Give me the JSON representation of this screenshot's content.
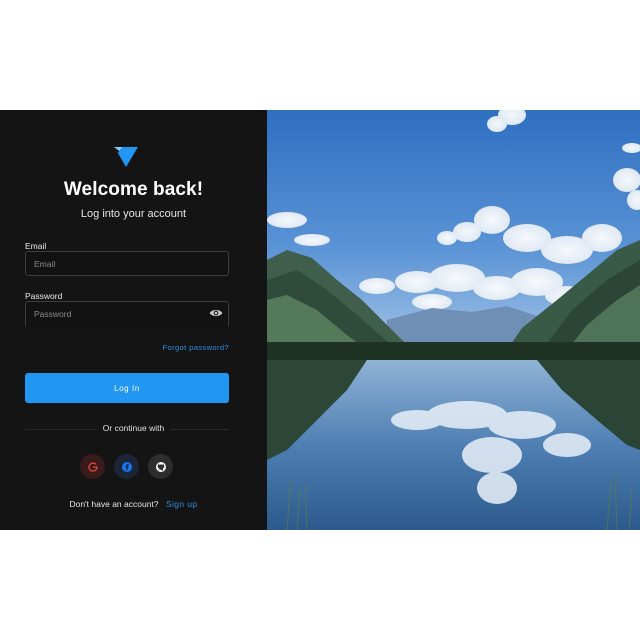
{
  "login": {
    "title": "Welcome back!",
    "subtitle": "Log into your account",
    "email": {
      "label": "Email",
      "placeholder": "Email",
      "value": ""
    },
    "password": {
      "label": "Password",
      "placeholder": "Password",
      "value": "",
      "toggle_icon": "eye-icon"
    },
    "forgot_password": "Forgot password?",
    "submit_label": "Log In",
    "divider_text": "Or continue with",
    "social": [
      {
        "name": "google",
        "icon": "google-icon",
        "color": "#e0493a"
      },
      {
        "name": "facebook",
        "icon": "facebook-icon",
        "color": "#1877f2"
      },
      {
        "name": "github",
        "icon": "github-icon",
        "color": "#ffffff"
      }
    ],
    "signup_prompt": "Don't have an account?",
    "signup_link": "Sign up"
  },
  "colors": {
    "panel_bg": "#141414",
    "accent": "#2196f3",
    "link": "#2f8fe8"
  },
  "hero": {
    "icon": "landscape-photo"
  }
}
